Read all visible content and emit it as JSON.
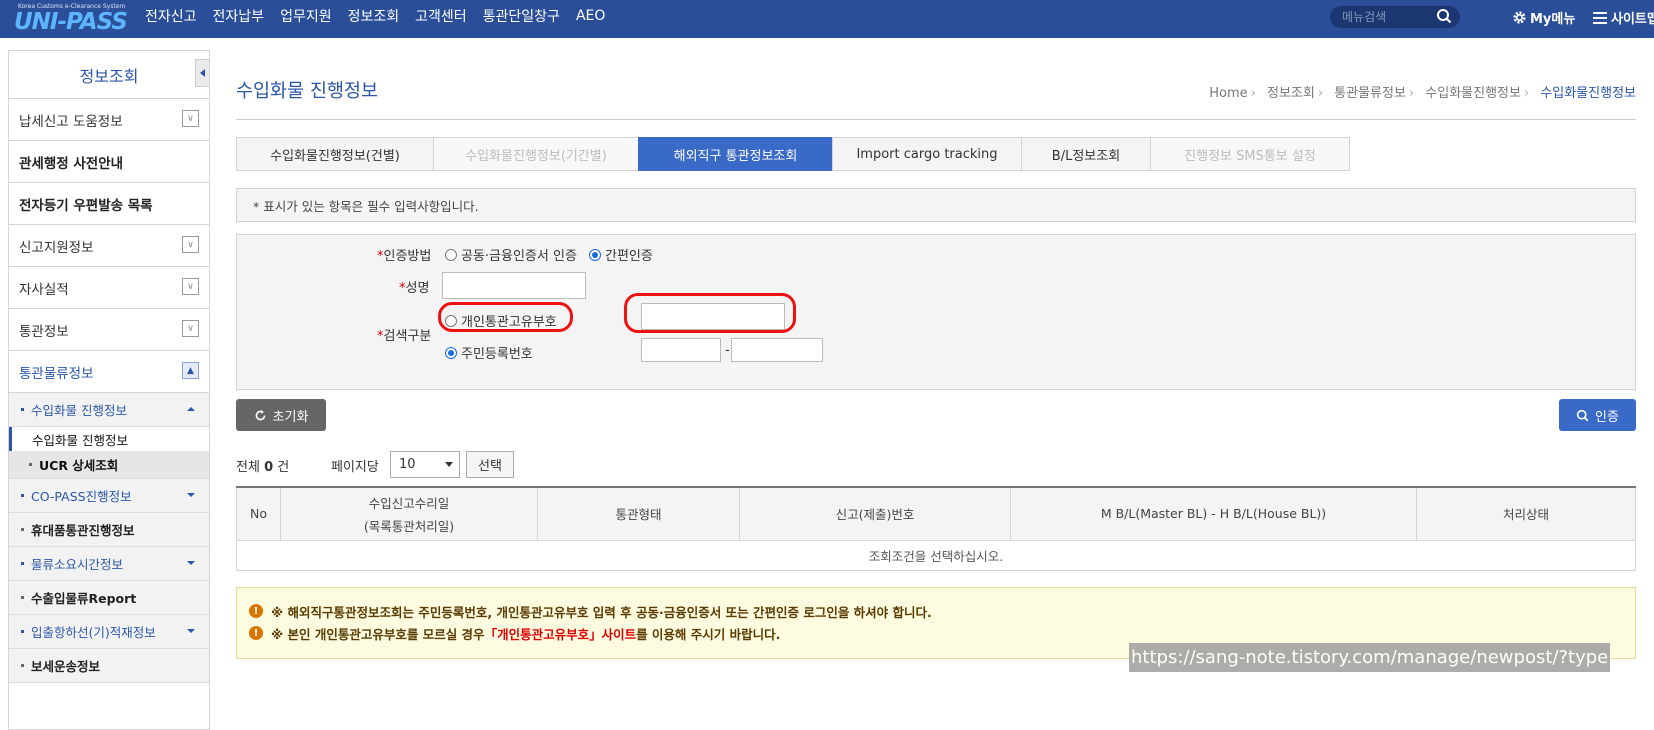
{
  "header": {
    "logo_small": "Korea Customs e-Clearance System",
    "logo_text": "UNI-PASS",
    "nav": [
      "전자신고",
      "전자납부",
      "업무지원",
      "정보조회",
      "고객센터",
      "통관단일창구",
      "AEO"
    ],
    "search_placeholder": "메뉴검색",
    "mymenu": "My메뉴",
    "sitemap": "사이트맵"
  },
  "sidebar": {
    "title": "정보조회",
    "items": [
      {
        "label": "납세신고 도움정보"
      },
      {
        "label": "관세행정 사전안내"
      },
      {
        "label": "전자등기 우편발송 목록"
      },
      {
        "label": "신고지원정보"
      },
      {
        "label": "자사실적"
      },
      {
        "label": "통관정보"
      },
      {
        "label": "통관물류정보"
      }
    ],
    "sub": [
      {
        "label": "수입화물 진행정보"
      },
      {
        "label": "수입화물 진행정보"
      },
      {
        "label": "UCR 상세조회"
      },
      {
        "label": "CO-PASS진행정보"
      },
      {
        "label": "휴대품통관진행정보"
      },
      {
        "label": "물류소요시간정보"
      },
      {
        "label": "수출입물류Report"
      },
      {
        "label": "입출항하선(기)적재정보"
      },
      {
        "label": "보세운송정보"
      }
    ]
  },
  "page": {
    "title": "수입화물 진행정보",
    "breadcrumb": [
      "Home",
      "정보조회",
      "통관물류정보",
      "수입화물진행정보",
      "수입화물진행정보"
    ]
  },
  "tabs": [
    {
      "label": "수입화물진행정보(건별)",
      "state": "normal"
    },
    {
      "label": "수입화물진행정보(기간별)",
      "state": "disabled"
    },
    {
      "label": "해외직구 통관정보조회",
      "state": "active"
    },
    {
      "label": "Import cargo tracking",
      "state": "normal"
    },
    {
      "label": "B/L정보조회",
      "state": "normal"
    },
    {
      "label": "진행정보 SMS통보 설정",
      "state": "disabled"
    }
  ],
  "notice": "* 표시가 있는 항목은 필수 입력사항입니다.",
  "form": {
    "auth_label": "인증방법",
    "auth_options": [
      "공동·금융인증서 인증",
      "간편인증"
    ],
    "auth_selected": "간편인증",
    "name_label": "성명",
    "name_value": "",
    "search_label": "검색구분",
    "search_options": [
      "개인통관고유부호",
      "주민등록번호"
    ],
    "search_selected": "주민등록번호",
    "customs_code_value": "",
    "rrn_front": "",
    "rrn_back": "",
    "dash": "-",
    "required_mark": "*"
  },
  "buttons": {
    "reset": "초기화",
    "auth": "인증",
    "select": "선택"
  },
  "results": {
    "total_prefix": "전체",
    "total_count": "0",
    "total_suffix": "건",
    "per_page_label": "페이지당",
    "per_page_value": "10",
    "columns": [
      "No",
      "수입신고수리일",
      "(목록통관처리일)",
      "통관형태",
      "신고(제출)번호",
      "M B/L(Master BL) - H B/L(House BL))",
      "처리상태"
    ],
    "empty_message": "조회조건을 선택하십시오."
  },
  "warnings": {
    "line1": "※ 해외직구통관정보조회는 주민등록번호, 개인통관고유부호 입력 후 공동·금융인증서 또는 간편인증 로그인을 하셔야 합니다.",
    "line2_before": "※ 본인 개인통관고유부호를 모르실 경우 ",
    "line2_link": "「개인통관고유부호」사이트",
    "line2_after": "를 이용해 주시기 바랍니다."
  },
  "watermark": "https://sang-note.tistory.com/manage/newpost/?type",
  "colors": {
    "header_bg": "#2a4f98",
    "accent": "#3a6ac7",
    "highlight": "#e11111"
  }
}
